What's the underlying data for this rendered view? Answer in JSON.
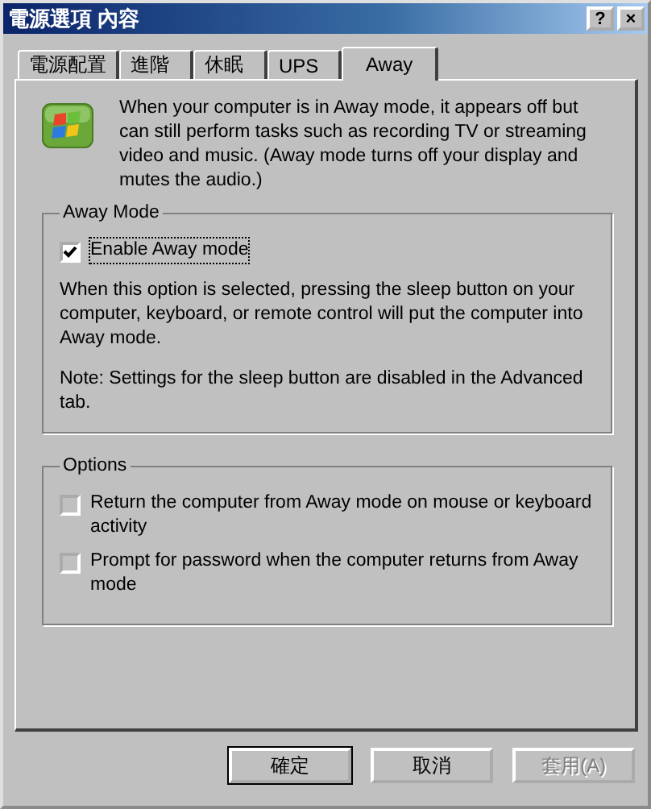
{
  "window": {
    "title": "電源選項 內容",
    "buttons": [
      "?",
      "×"
    ]
  },
  "tabs": [
    {
      "label": "電源配置",
      "selected": false
    },
    {
      "label": "進階",
      "selected": false
    },
    {
      "label": "休眠",
      "selected": false
    },
    {
      "label": "UPS",
      "selected": false
    },
    {
      "label": "Away",
      "selected": true
    }
  ],
  "intro": "When your computer is in Away mode, it appears off but can still perform tasks such as recording TV or streaming video and music. (Away mode turns off your display and mutes the audio.)",
  "groups": [
    {
      "title": "Away Mode",
      "items": [
        {
          "kind": "checkbox",
          "label": "Enable Away mode",
          "checked": true,
          "disabled": false,
          "focused": true
        },
        {
          "kind": "text",
          "text": "When this option is selected, pressing the sleep button on your computer, keyboard, or remote control will put the computer into Away mode."
        },
        {
          "kind": "text",
          "text": "Note: Settings for the sleep button are disabled in the Advanced tab."
        }
      ]
    },
    {
      "title": "Options",
      "items": [
        {
          "kind": "checkbox",
          "label": "Return the computer from Away mode on mouse or keyboard activity",
          "checked": false,
          "disabled": true,
          "focused": false
        },
        {
          "kind": "checkbox",
          "label": "Prompt for password when the computer returns from Away mode",
          "checked": false,
          "disabled": true,
          "focused": false
        }
      ]
    }
  ],
  "buttons": [
    {
      "label": "確定",
      "disabled": false,
      "default": true
    },
    {
      "label": "取消",
      "disabled": false,
      "default": false
    },
    {
      "label": "套用(A)",
      "disabled": true,
      "default": false
    }
  ]
}
